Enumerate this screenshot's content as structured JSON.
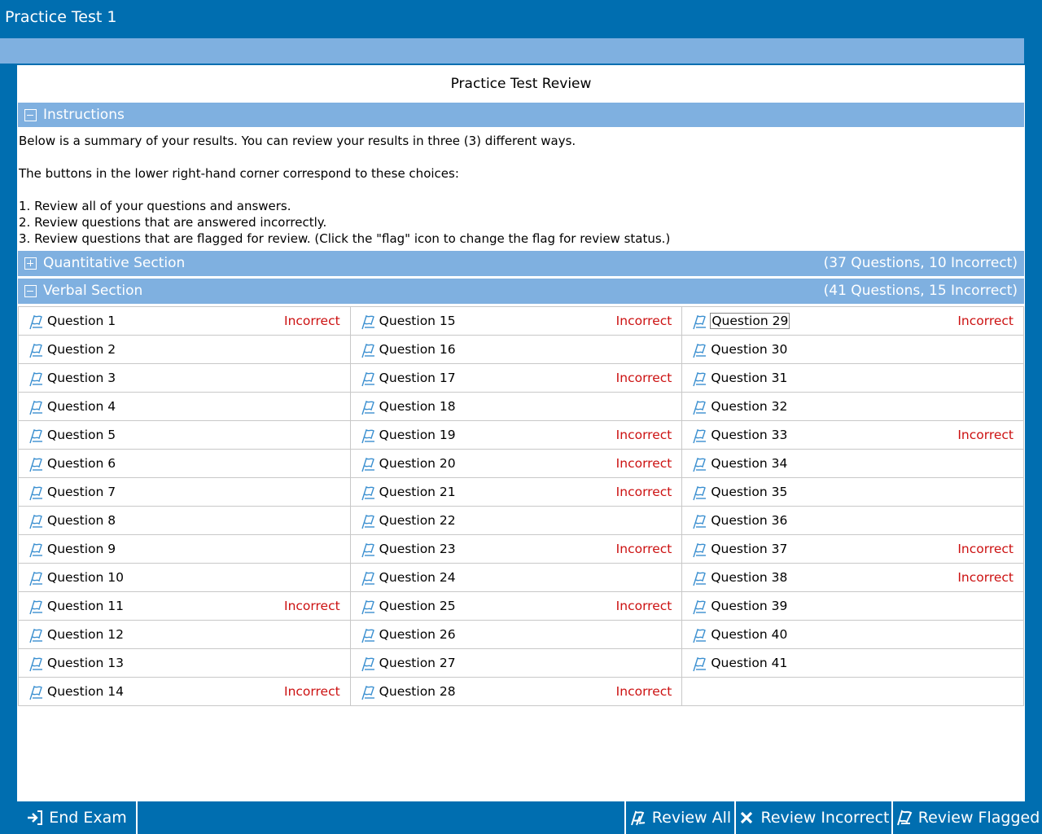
{
  "app": {
    "title": "Practice Test 1"
  },
  "review": {
    "title": "Practice Test Review"
  },
  "instructions": {
    "header": "Instructions",
    "lines": [
      "Below is a summary of your results. You can review your results in three (3) different ways.",
      "",
      "The buttons in the lower right-hand corner correspond to these choices:",
      "",
      "1. Review all of your questions and answers.",
      "2. Review questions that are answered incorrectly.",
      "3. Review questions that are flagged for review. (Click the \"flag\" icon to change the flag for review status.)"
    ]
  },
  "sections": [
    {
      "label": "Quantitative Section",
      "summary": "(37 Questions, 10 Incorrect)",
      "expanded": false
    },
    {
      "label": "Verbal Section",
      "summary": "(41 Questions, 15 Incorrect)",
      "expanded": true
    }
  ],
  "questions": {
    "incorrect_label": "Incorrect",
    "columns": [
      [
        {
          "label": "Question 1",
          "status": "Incorrect"
        },
        {
          "label": "Question 2",
          "status": ""
        },
        {
          "label": "Question 3",
          "status": ""
        },
        {
          "label": "Question 4",
          "status": ""
        },
        {
          "label": "Question 5",
          "status": ""
        },
        {
          "label": "Question 6",
          "status": ""
        },
        {
          "label": "Question 7",
          "status": ""
        },
        {
          "label": "Question 8",
          "status": ""
        },
        {
          "label": "Question 9",
          "status": ""
        },
        {
          "label": "Question 10",
          "status": ""
        },
        {
          "label": "Question 11",
          "status": "Incorrect"
        },
        {
          "label": "Question 12",
          "status": ""
        },
        {
          "label": "Question 13",
          "status": ""
        },
        {
          "label": "Question 14",
          "status": "Incorrect"
        }
      ],
      [
        {
          "label": "Question 15",
          "status": "Incorrect"
        },
        {
          "label": "Question 16",
          "status": ""
        },
        {
          "label": "Question 17",
          "status": "Incorrect"
        },
        {
          "label": "Question 18",
          "status": ""
        },
        {
          "label": "Question 19",
          "status": "Incorrect"
        },
        {
          "label": "Question 20",
          "status": "Incorrect"
        },
        {
          "label": "Question 21",
          "status": "Incorrect"
        },
        {
          "label": "Question 22",
          "status": ""
        },
        {
          "label": "Question 23",
          "status": "Incorrect"
        },
        {
          "label": "Question 24",
          "status": ""
        },
        {
          "label": "Question 25",
          "status": "Incorrect"
        },
        {
          "label": "Question 26",
          "status": ""
        },
        {
          "label": "Question 27",
          "status": ""
        },
        {
          "label": "Question 28",
          "status": "Incorrect"
        }
      ],
      [
        {
          "label": "Question 29",
          "status": "Incorrect",
          "selected": true
        },
        {
          "label": "Question 30",
          "status": ""
        },
        {
          "label": "Question 31",
          "status": ""
        },
        {
          "label": "Question 32",
          "status": ""
        },
        {
          "label": "Question 33",
          "status": "Incorrect"
        },
        {
          "label": "Question 34",
          "status": ""
        },
        {
          "label": "Question 35",
          "status": ""
        },
        {
          "label": "Question 36",
          "status": ""
        },
        {
          "label": "Question 37",
          "status": "Incorrect"
        },
        {
          "label": "Question 38",
          "status": "Incorrect"
        },
        {
          "label": "Question 39",
          "status": ""
        },
        {
          "label": "Question 40",
          "status": ""
        },
        {
          "label": "Question 41",
          "status": ""
        }
      ]
    ]
  },
  "toolbar": {
    "end_exam": "End Exam",
    "review_all": "Review All",
    "review_incorrect": "Review Incorrect",
    "review_flagged": "Review Flagged"
  },
  "icons": {
    "flag": "flag-icon",
    "end_exam": "exit-arrow-icon",
    "review_all": "flag-stack-icon",
    "review_incorrect": "x-icon",
    "review_flagged": "flag-icon"
  },
  "colors": {
    "primary": "#006eb0",
    "section_header": "#7fb0e0",
    "incorrect": "#cc1111",
    "flag": "#3a8fd0"
  }
}
